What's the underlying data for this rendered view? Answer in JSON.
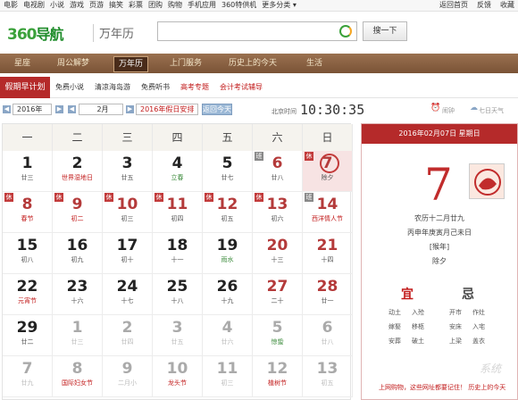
{
  "topbar": {
    "left": [
      "电影",
      "电视剧",
      "小说",
      "游戏",
      "页游",
      "搞笑",
      "彩票",
      "团购",
      "购物",
      "手机应用",
      "360特供机",
      "更多分类 ▾"
    ],
    "right": [
      "返回首页",
      "反馈",
      "收藏"
    ]
  },
  "header": {
    "logo": "360",
    "logo_hz": "导航",
    "sub": "万年历",
    "search_placeholder": "",
    "search_button": "搜一下"
  },
  "nav": [
    "星座",
    "周公解梦",
    "万年历",
    "上门服务",
    "历史上的今天",
    "生活"
  ],
  "subnav": {
    "first": "假期早计划",
    "items": [
      "免费小说",
      "清凉海岛游",
      "免费听书",
      "高考专题",
      "会计考试辅导"
    ]
  },
  "controls": {
    "year": "2016年",
    "month": "2月",
    "holiday": "2016年假日安排",
    "today_button": "返回今天",
    "clock_label": "北京时间",
    "clock": "10:30:35",
    "alarm": "闹钟",
    "weather": "七日天气"
  },
  "weekdays": [
    "一",
    "二",
    "三",
    "四",
    "五",
    "六",
    "日"
  ],
  "days": [
    {
      "d": "1",
      "lu": "廿三"
    },
    {
      "d": "2",
      "lu": "世界湿地日",
      "t": "fes"
    },
    {
      "d": "3",
      "lu": "廿五"
    },
    {
      "d": "4",
      "lu": "立春",
      "t": "tm"
    },
    {
      "d": "5",
      "lu": "廿七"
    },
    {
      "d": "6",
      "lu": "廿八",
      "wk": true,
      "tag": "班",
      "tagt": "ban"
    },
    {
      "d": "7",
      "lu": "除夕",
      "wk": true,
      "tag": "休",
      "hl": true,
      "circle": true
    },
    {
      "d": "8",
      "lu": "春节",
      "t": "fes",
      "wk": true,
      "tag": "休"
    },
    {
      "d": "9",
      "lu": "初二",
      "t": "fes",
      "wk": true,
      "tag": "休"
    },
    {
      "d": "10",
      "lu": "初三",
      "wk": true,
      "tag": "休"
    },
    {
      "d": "11",
      "lu": "初四",
      "wk": true,
      "tag": "休"
    },
    {
      "d": "12",
      "lu": "初五",
      "wk": true,
      "tag": "休"
    },
    {
      "d": "13",
      "lu": "初六",
      "wk": true,
      "tag": "休"
    },
    {
      "d": "14",
      "lu": "西洋情人节",
      "t": "fes",
      "wk": true,
      "tag": "班",
      "tagt": "ban"
    },
    {
      "d": "15",
      "lu": "初八"
    },
    {
      "d": "16",
      "lu": "初九"
    },
    {
      "d": "17",
      "lu": "初十"
    },
    {
      "d": "18",
      "lu": "十一"
    },
    {
      "d": "19",
      "lu": "雨水",
      "t": "tm"
    },
    {
      "d": "20",
      "lu": "十三",
      "wk": true
    },
    {
      "d": "21",
      "lu": "十四",
      "wk": true
    },
    {
      "d": "22",
      "lu": "元宵节",
      "t": "fes"
    },
    {
      "d": "23",
      "lu": "十六"
    },
    {
      "d": "24",
      "lu": "十七"
    },
    {
      "d": "25",
      "lu": "十八"
    },
    {
      "d": "26",
      "lu": "十九"
    },
    {
      "d": "27",
      "lu": "二十",
      "wk": true
    },
    {
      "d": "28",
      "lu": "廿一",
      "wk": true
    },
    {
      "d": "29",
      "lu": "廿二"
    },
    {
      "d": "1",
      "lu": "廿三",
      "oth": true
    },
    {
      "d": "2",
      "lu": "廿四",
      "oth": true
    },
    {
      "d": "3",
      "lu": "廿五",
      "oth": true
    },
    {
      "d": "4",
      "lu": "廿六",
      "oth": true
    },
    {
      "d": "5",
      "lu": "惊蛰",
      "t": "tm",
      "oth": true
    },
    {
      "d": "6",
      "lu": "廿八",
      "oth": true
    },
    {
      "d": "7",
      "lu": "廿九",
      "oth": true
    },
    {
      "d": "8",
      "lu": "国际妇女节",
      "t": "fes",
      "oth": true
    },
    {
      "d": "9",
      "lu": "二月小",
      "oth": true
    },
    {
      "d": "10",
      "lu": "龙头节",
      "t": "fes",
      "oth": true
    },
    {
      "d": "11",
      "lu": "初三",
      "oth": true
    },
    {
      "d": "12",
      "lu": "植树节",
      "t": "fes",
      "oth": true
    },
    {
      "d": "13",
      "lu": "初五",
      "oth": true
    }
  ],
  "panel": {
    "header": "2016年02月07日 星期日",
    "day": "7",
    "lunar": "农历十二月廿九",
    "ganzhi": "丙申年庚寅月己未日",
    "zodiac": "[猴年]",
    "festival": "除夕",
    "yi": "宜",
    "ji": "忌",
    "yi_items": [
      "动土",
      "入殓",
      "嫁娶",
      "移柩",
      "安葬",
      "破土"
    ],
    "ji_items": [
      "开市",
      "作灶",
      "安床",
      "入宅",
      "上梁",
      "盖衣"
    ]
  },
  "overlay": {
    "watermark": "系统",
    "note": "上网购物，这些网址都要记住！ 历史上的今天"
  }
}
